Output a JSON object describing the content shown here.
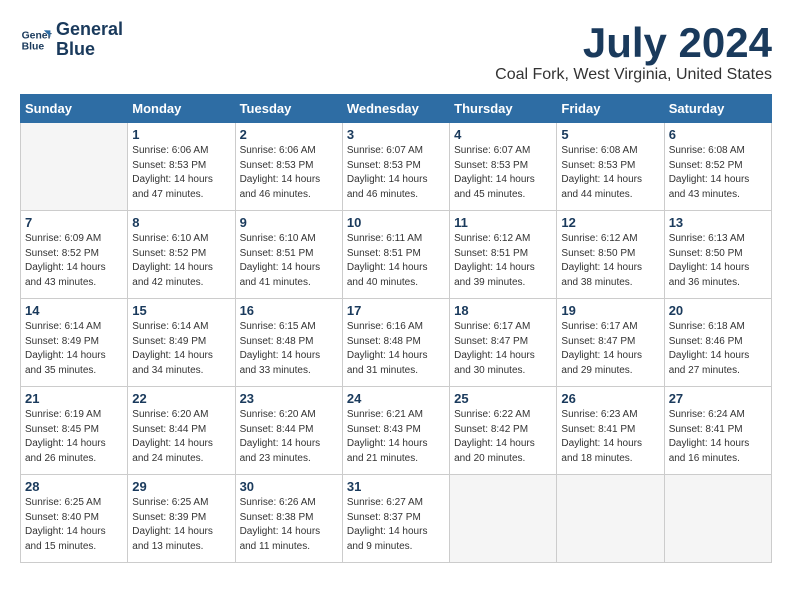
{
  "logo": {
    "line1": "General",
    "line2": "Blue"
  },
  "title": "July 2024",
  "subtitle": "Coal Fork, West Virginia, United States",
  "days_of_week": [
    "Sunday",
    "Monday",
    "Tuesday",
    "Wednesday",
    "Thursday",
    "Friday",
    "Saturday"
  ],
  "weeks": [
    [
      {
        "day": "",
        "info": ""
      },
      {
        "day": "1",
        "info": "Sunrise: 6:06 AM\nSunset: 8:53 PM\nDaylight: 14 hours\nand 47 minutes."
      },
      {
        "day": "2",
        "info": "Sunrise: 6:06 AM\nSunset: 8:53 PM\nDaylight: 14 hours\nand 46 minutes."
      },
      {
        "day": "3",
        "info": "Sunrise: 6:07 AM\nSunset: 8:53 PM\nDaylight: 14 hours\nand 46 minutes."
      },
      {
        "day": "4",
        "info": "Sunrise: 6:07 AM\nSunset: 8:53 PM\nDaylight: 14 hours\nand 45 minutes."
      },
      {
        "day": "5",
        "info": "Sunrise: 6:08 AM\nSunset: 8:53 PM\nDaylight: 14 hours\nand 44 minutes."
      },
      {
        "day": "6",
        "info": "Sunrise: 6:08 AM\nSunset: 8:52 PM\nDaylight: 14 hours\nand 43 minutes."
      }
    ],
    [
      {
        "day": "7",
        "info": "Sunrise: 6:09 AM\nSunset: 8:52 PM\nDaylight: 14 hours\nand 43 minutes."
      },
      {
        "day": "8",
        "info": "Sunrise: 6:10 AM\nSunset: 8:52 PM\nDaylight: 14 hours\nand 42 minutes."
      },
      {
        "day": "9",
        "info": "Sunrise: 6:10 AM\nSunset: 8:51 PM\nDaylight: 14 hours\nand 41 minutes."
      },
      {
        "day": "10",
        "info": "Sunrise: 6:11 AM\nSunset: 8:51 PM\nDaylight: 14 hours\nand 40 minutes."
      },
      {
        "day": "11",
        "info": "Sunrise: 6:12 AM\nSunset: 8:51 PM\nDaylight: 14 hours\nand 39 minutes."
      },
      {
        "day": "12",
        "info": "Sunrise: 6:12 AM\nSunset: 8:50 PM\nDaylight: 14 hours\nand 38 minutes."
      },
      {
        "day": "13",
        "info": "Sunrise: 6:13 AM\nSunset: 8:50 PM\nDaylight: 14 hours\nand 36 minutes."
      }
    ],
    [
      {
        "day": "14",
        "info": "Sunrise: 6:14 AM\nSunset: 8:49 PM\nDaylight: 14 hours\nand 35 minutes."
      },
      {
        "day": "15",
        "info": "Sunrise: 6:14 AM\nSunset: 8:49 PM\nDaylight: 14 hours\nand 34 minutes."
      },
      {
        "day": "16",
        "info": "Sunrise: 6:15 AM\nSunset: 8:48 PM\nDaylight: 14 hours\nand 33 minutes."
      },
      {
        "day": "17",
        "info": "Sunrise: 6:16 AM\nSunset: 8:48 PM\nDaylight: 14 hours\nand 31 minutes."
      },
      {
        "day": "18",
        "info": "Sunrise: 6:17 AM\nSunset: 8:47 PM\nDaylight: 14 hours\nand 30 minutes."
      },
      {
        "day": "19",
        "info": "Sunrise: 6:17 AM\nSunset: 8:47 PM\nDaylight: 14 hours\nand 29 minutes."
      },
      {
        "day": "20",
        "info": "Sunrise: 6:18 AM\nSunset: 8:46 PM\nDaylight: 14 hours\nand 27 minutes."
      }
    ],
    [
      {
        "day": "21",
        "info": "Sunrise: 6:19 AM\nSunset: 8:45 PM\nDaylight: 14 hours\nand 26 minutes."
      },
      {
        "day": "22",
        "info": "Sunrise: 6:20 AM\nSunset: 8:44 PM\nDaylight: 14 hours\nand 24 minutes."
      },
      {
        "day": "23",
        "info": "Sunrise: 6:20 AM\nSunset: 8:44 PM\nDaylight: 14 hours\nand 23 minutes."
      },
      {
        "day": "24",
        "info": "Sunrise: 6:21 AM\nSunset: 8:43 PM\nDaylight: 14 hours\nand 21 minutes."
      },
      {
        "day": "25",
        "info": "Sunrise: 6:22 AM\nSunset: 8:42 PM\nDaylight: 14 hours\nand 20 minutes."
      },
      {
        "day": "26",
        "info": "Sunrise: 6:23 AM\nSunset: 8:41 PM\nDaylight: 14 hours\nand 18 minutes."
      },
      {
        "day": "27",
        "info": "Sunrise: 6:24 AM\nSunset: 8:41 PM\nDaylight: 14 hours\nand 16 minutes."
      }
    ],
    [
      {
        "day": "28",
        "info": "Sunrise: 6:25 AM\nSunset: 8:40 PM\nDaylight: 14 hours\nand 15 minutes."
      },
      {
        "day": "29",
        "info": "Sunrise: 6:25 AM\nSunset: 8:39 PM\nDaylight: 14 hours\nand 13 minutes."
      },
      {
        "day": "30",
        "info": "Sunrise: 6:26 AM\nSunset: 8:38 PM\nDaylight: 14 hours\nand 11 minutes."
      },
      {
        "day": "31",
        "info": "Sunrise: 6:27 AM\nSunset: 8:37 PM\nDaylight: 14 hours\nand 9 minutes."
      },
      {
        "day": "",
        "info": ""
      },
      {
        "day": "",
        "info": ""
      },
      {
        "day": "",
        "info": ""
      }
    ]
  ]
}
